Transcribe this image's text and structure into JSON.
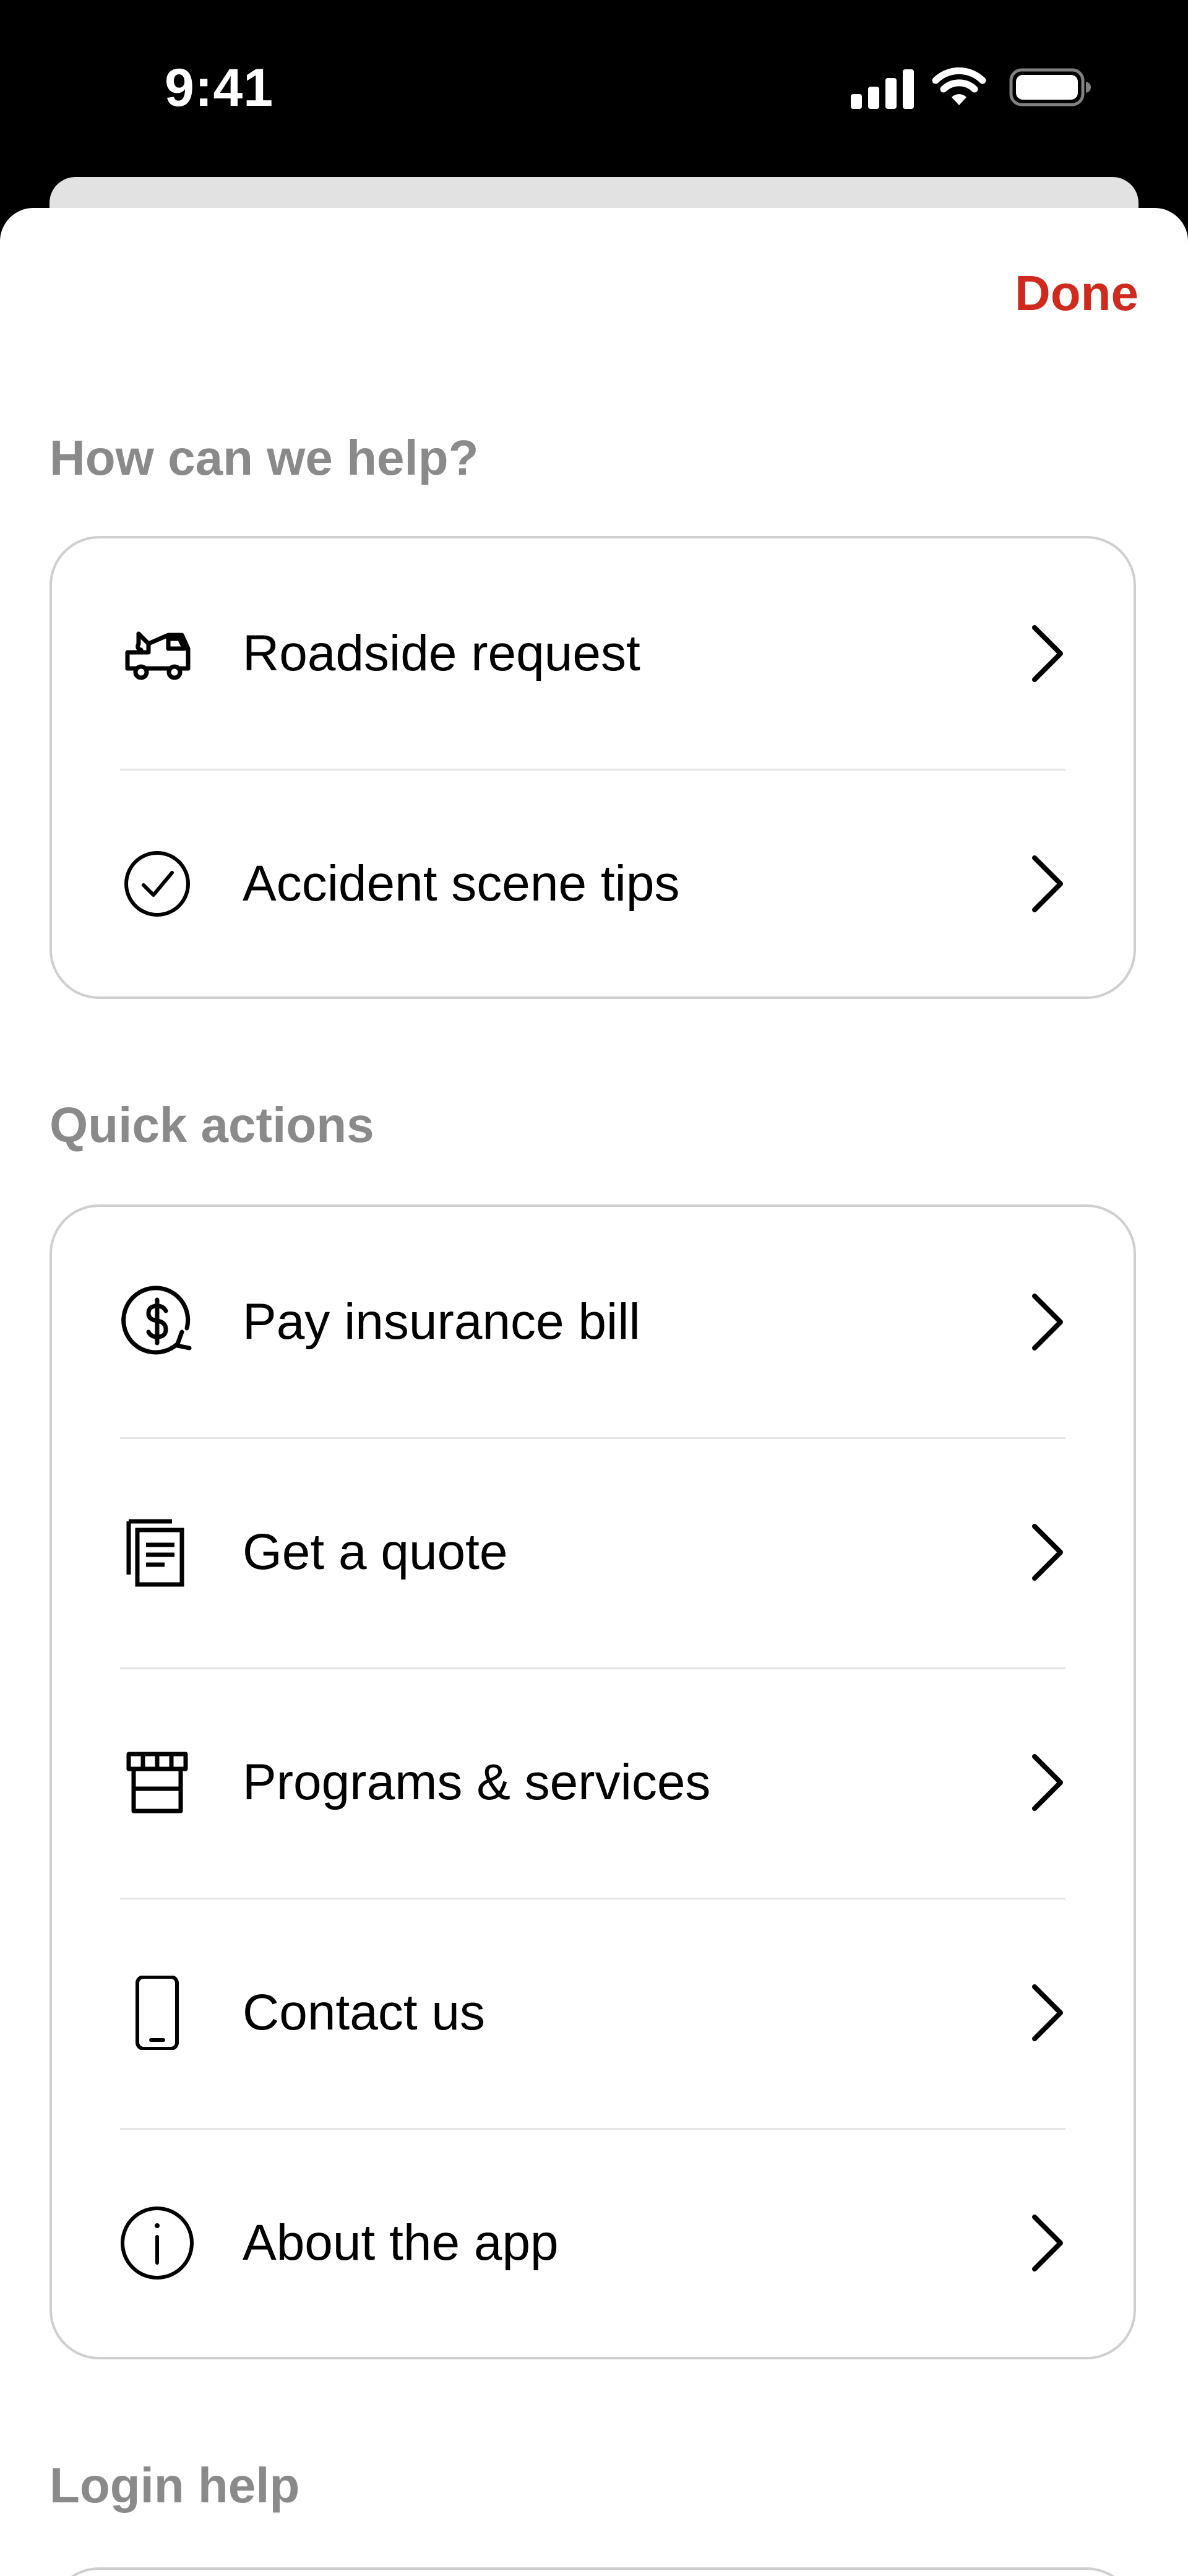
{
  "status_bar": {
    "time": "9:41"
  },
  "sheet": {
    "done_label": "Done"
  },
  "sections": {
    "help": {
      "title": "How can we help?",
      "items": [
        {
          "label": "Roadside request",
          "icon": "tow-truck-icon"
        },
        {
          "label": "Accident scene tips",
          "icon": "check-circle-icon"
        }
      ]
    },
    "quick_actions": {
      "title": "Quick actions",
      "items": [
        {
          "label": "Pay insurance bill",
          "icon": "dollar-circle-icon"
        },
        {
          "label": "Get a quote",
          "icon": "documents-icon"
        },
        {
          "label": "Programs & services",
          "icon": "storefront-icon"
        },
        {
          "label": "Contact us",
          "icon": "phone-icon"
        },
        {
          "label": "About the app",
          "icon": "info-circle-icon"
        }
      ]
    },
    "login_help": {
      "title": "Login help"
    }
  },
  "colors": {
    "accent": "#cf2a1d",
    "section_title": "#8a8a8a",
    "card_border": "#cfcfcf",
    "divider": "#e4e4e4"
  }
}
